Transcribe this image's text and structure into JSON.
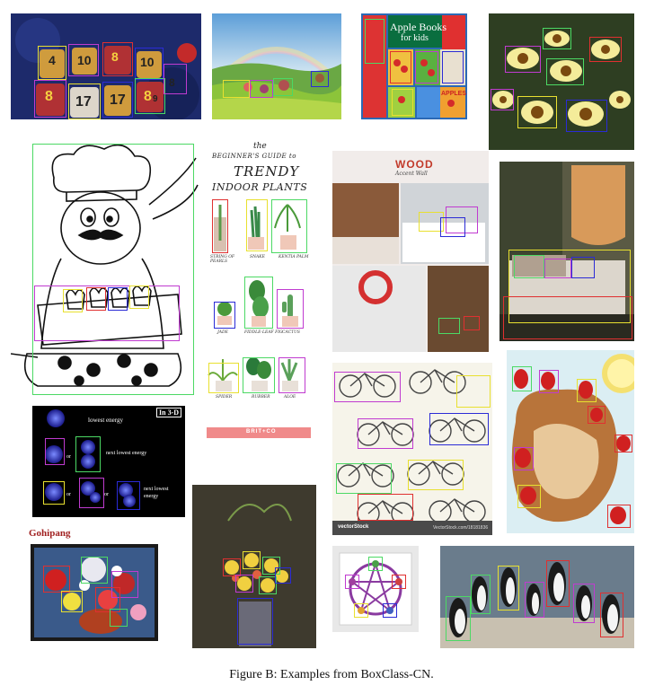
{
  "caption": "Figure B: Examples from BoxClass-CN.",
  "colors": {
    "green": "#4cd964",
    "purple": "#c03bd0",
    "blue": "#2b2bd6",
    "red": "#e03030",
    "yellow": "#e8e030",
    "pink": "#ff55aa",
    "olive": "#a8a828"
  },
  "panels": {
    "jerseys": {
      "numbers": [
        "4",
        "10",
        "8",
        "10",
        "8",
        "17",
        "17",
        "8",
        "9",
        "8"
      ]
    },
    "plants": {
      "the": "the",
      "title1": "BEGINNER'S GUIDE to",
      "title2": "TRENDY",
      "title3": "INDOOR PLANTS",
      "row1": [
        "STRING OF PEARLS",
        "SNAKE",
        "KENTIA PALM"
      ],
      "row2": [
        "JADE",
        "FIDDLE-LEAF FIG",
        "CACTUS"
      ],
      "row3": [
        "SPIDER",
        "RUBBER",
        "ALOE"
      ],
      "brand": "BRIT+CO"
    },
    "wood": {
      "title": "WOOD",
      "subtitle": "Accent Wall"
    },
    "books": {
      "line1": "Apple Books",
      "line2": "for kids",
      "apples": "APPLES"
    },
    "energy": {
      "badge": "In 3-D",
      "lowest": "lowest energy",
      "or1": "or",
      "next_lowest": "next lowest energy",
      "or2": "or",
      "or3": "or",
      "next_lowest2a": "next lowest",
      "next_lowest2b": "energy"
    },
    "gohipang": {
      "title": "Gohipang"
    },
    "bikes": {
      "brand": "vectorStock",
      "url": "VectorStock.com/18181836"
    }
  }
}
